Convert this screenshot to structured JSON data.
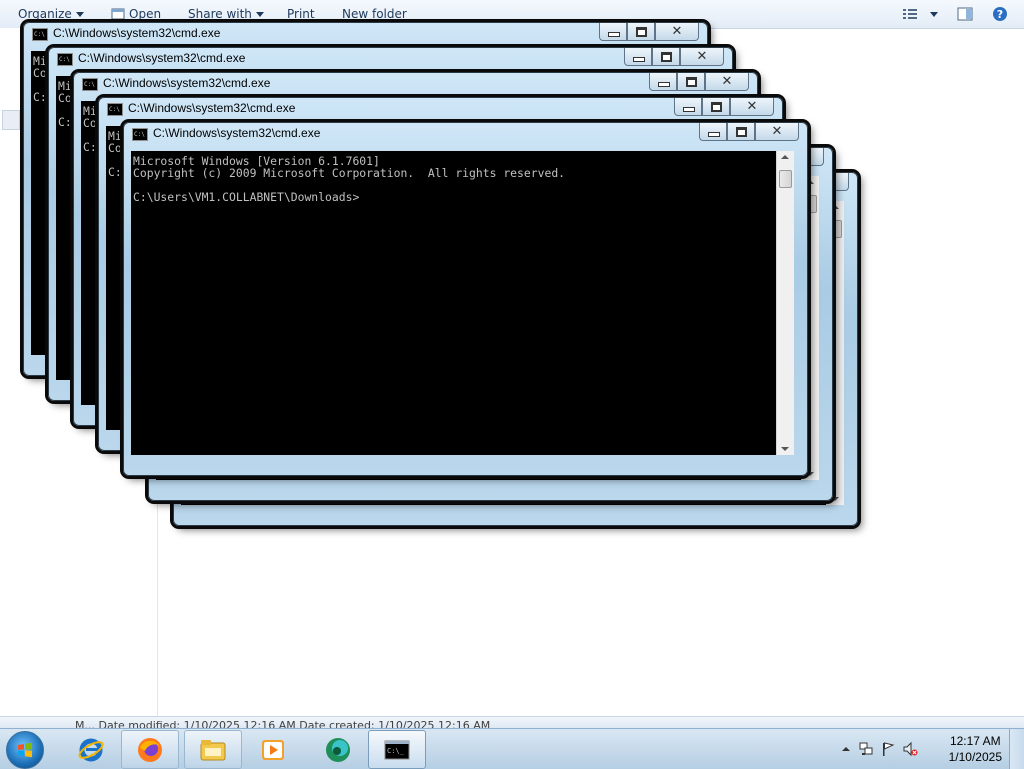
{
  "explorer": {
    "toolbar": {
      "organize": "Organize",
      "open": "Open",
      "share_with": "Share with",
      "print": "Print",
      "new_folder": "New folder"
    },
    "details_text": "M...        Date modified: 1/10/2025 12:16 AM        Date created: 1/10/2025 12:16 AM"
  },
  "cmd_windows": [
    {
      "title": "C:\\Windows\\system32\\cmd.exe",
      "console": "Microsoft Windows [Version 6.1.7601]\nCopyright (c) 2009 Microsoft Corporation.  All rights reserved.\n\nC:\\Users\\VM1.COLLABNET\\Downloads>"
    },
    {
      "title": "C:\\Windows\\system32\\cmd.exe",
      "console": "Microsoft Windows [Version 6.1.7601]\nCopyright (c) 2009 Microsoft Corporation.  All rights reserved.\n\nC:\\Users\\VM1.COLLABNET\\Downloads>"
    },
    {
      "title": "C:\\Windows\\system32\\cmd.exe",
      "console": "Microsoft Windows [Version 6.1.7601]\nCopyright (c) 2009 Microsoft Corporation.  All rights reserved.\n\nC:\\Users\\VM1.COLLABNET\\Downloads>"
    },
    {
      "title": "C:\\Windows\\system32\\cmd.exe",
      "console": "Microsoft Windows [Version 6.1.7601]\nCopyright (c) 2009 Microsoft Corporation.  All rights reserved.\n\nC:\\Users\\VM1.COLLABNET\\Downloads>"
    },
    {
      "title": "C:\\Windows\\system32\\cmd.exe",
      "console": "Microsoft Windows [Version 6.1.7601]\nCopyright (c) 2009 Microsoft Corporation.  All rights reserved.\n\nC:\\Users\\VM1.COLLABNET\\Downloads>"
    },
    {
      "title": "C:\\Windows\\system32\\cmd.exe",
      "console": "Microsoft Windows [Version 6.1.7601]\nCopyright (c) 2009 Microsoft Corporation.  All rights reserved.\n\nC:\\Users\\VM1.COLLABNET\\Downloads>"
    },
    {
      "title": "C:\\Windows\\system32\\cmd.exe",
      "console": "Microsoft Windows [Version 6.1.7601]\nCopyright (c) 2009 Microsoft Corporation.  All rights reserved.\n\nC:\\Users\\VM1.COLLABNET\\Downloads>"
    }
  ],
  "taskbar": {
    "pinned": [
      {
        "name": "internet-explorer-icon"
      },
      {
        "name": "firefox-icon"
      },
      {
        "name": "windows-explorer-icon"
      },
      {
        "name": "media-player-icon"
      },
      {
        "name": "app-icon"
      },
      {
        "name": "cmd-icon"
      }
    ],
    "clock_time": "12:17 AM",
    "clock_date": "1/10/2025"
  },
  "colors": {
    "console_bg": "#000000",
    "console_fg": "#c0c0c0",
    "taskbar": "#c7dbee",
    "window_frame": "#bad7ec"
  }
}
